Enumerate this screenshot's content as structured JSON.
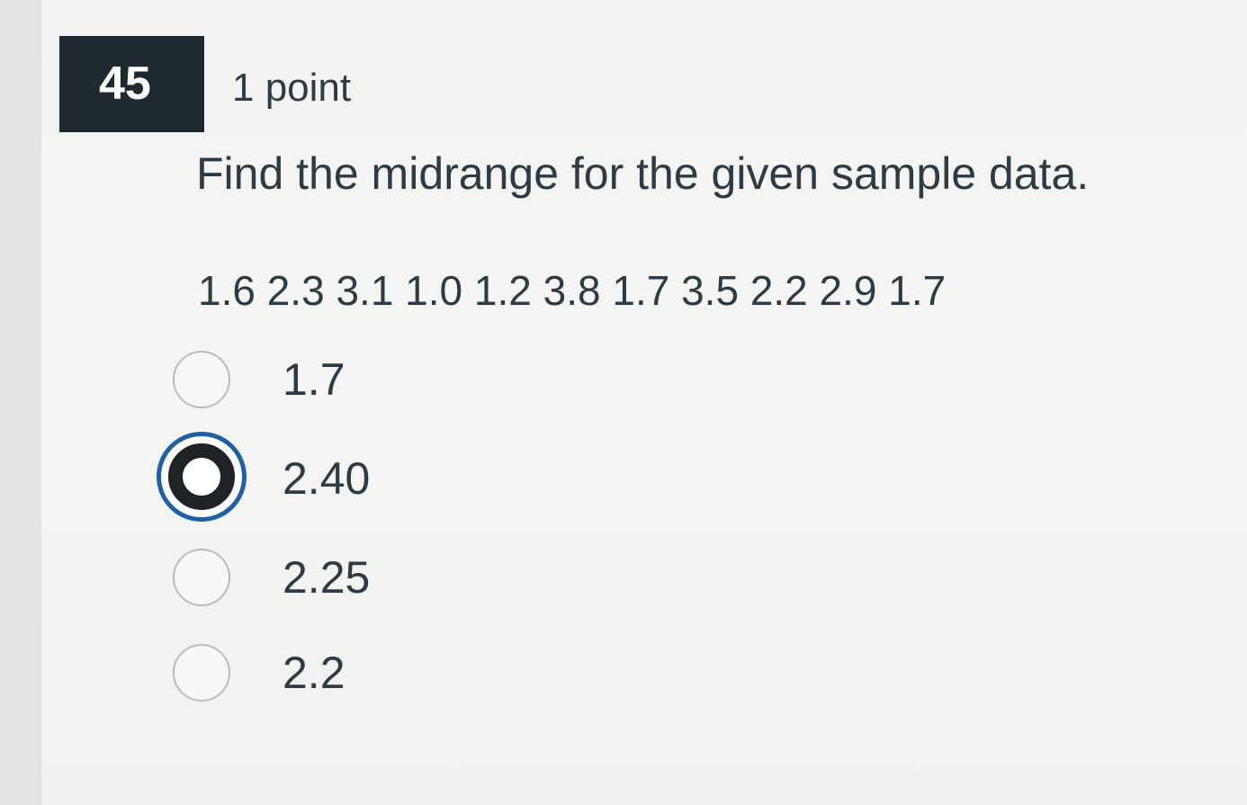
{
  "question": {
    "number": "45",
    "points": "1 point",
    "prompt": "Find the midrange for the given sample data.",
    "sample_data": "1.6 2.3 3.1 1.0 1.2 3.8 1.7 3.5 2.2 2.9 1.7"
  },
  "options": [
    {
      "label": "1.7",
      "selected": false
    },
    {
      "label": "2.40",
      "selected": true
    },
    {
      "label": "2.25",
      "selected": false
    },
    {
      "label": "2.2",
      "selected": false
    }
  ],
  "colors": {
    "number_badge_bg": "#1f2a30",
    "text": "#2d3b45",
    "selected_ring": "#1f5fa6"
  }
}
